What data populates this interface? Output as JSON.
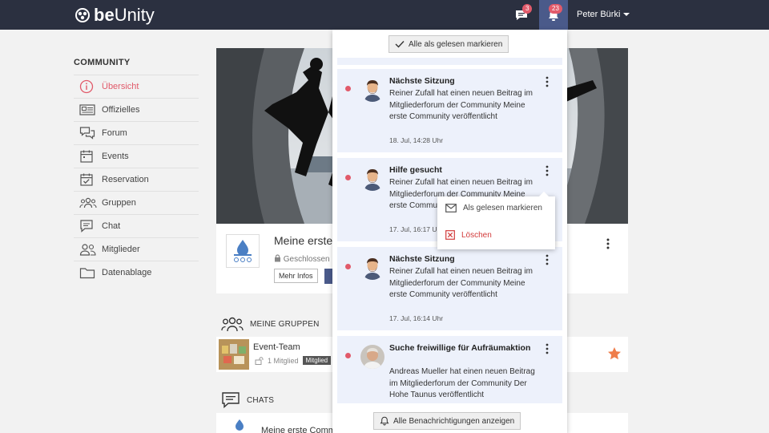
{
  "app": {
    "logo_be": "be",
    "logo_unity": "Unity",
    "user_name": "Peter Bürki",
    "chat_badge": "3",
    "notif_badge": "23"
  },
  "sidebar": {
    "title": "COMMUNITY",
    "items": [
      {
        "label": "Übersicht",
        "icon": "info-icon"
      },
      {
        "label": "Offizielles",
        "icon": "newspaper-icon"
      },
      {
        "label": "Forum",
        "icon": "forum-icon"
      },
      {
        "label": "Events",
        "icon": "calendar-icon"
      },
      {
        "label": "Reservation",
        "icon": "calendar-check-icon"
      },
      {
        "label": "Gruppen",
        "icon": "group-icon"
      },
      {
        "label": "Chat",
        "icon": "chat-icon"
      },
      {
        "label": "Mitglieder",
        "icon": "members-icon"
      },
      {
        "label": "Datenablage",
        "icon": "folder-icon"
      }
    ]
  },
  "main": {
    "group_title": "Meine erste",
    "closed_label": "Geschlossen",
    "more_info": "Mehr Infos",
    "my_groups": "MEINE GRUPPEN",
    "group_row": {
      "name": "Event-Team",
      "members": "1 Mitglied",
      "tag": "Mitglied"
    },
    "chats": "CHATS",
    "chat_row_name": "Meine erste Comm"
  },
  "notifications": {
    "mark_all": "Alle als gelesen markieren",
    "show_all": "Alle Benachrichtigungen anzeigen",
    "items": [
      {
        "title": "Nächste Sitzung",
        "body": "Reiner Zufall hat einen neuen Beitrag im Mitgliederforum der Community Meine erste Community veröffentlicht",
        "time": "18. Jul, 14:28 Uhr"
      },
      {
        "title": "Hilfe gesucht",
        "body": "Reiner Zufall hat einen neuen Beitrag im Mitgliederforum der Community Meine erste Community veröffentlicht",
        "time": "17. Jul, 16:17 Uhr"
      },
      {
        "title": "Nächste Sitzung",
        "body": "Reiner Zufall hat einen neuen Beitrag im Mitgliederforum der Community Meine erste Community veröffentlicht",
        "time": "17. Jul, 16:14 Uhr"
      },
      {
        "title": "Suche freiwillige für Aufräumaktion",
        "body": "Andreas Mueller hat einen neuen Beitrag im Mitgliederforum der Community Der Hohe Taunus veröffentlicht",
        "time": ""
      }
    ]
  },
  "context_menu": {
    "mark_read": "Als gelesen markieren",
    "delete": "Löschen"
  },
  "colors": {
    "topbar": "#2b3040",
    "accent": "#e15a6a",
    "notif_bg": "#edf1fb",
    "active_bell": "#4a5a8a"
  }
}
